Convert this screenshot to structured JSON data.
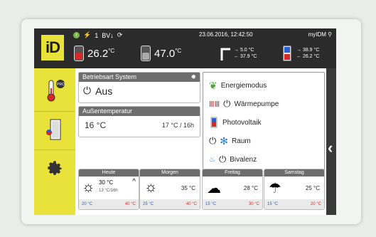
{
  "topbar": {
    "status_icons": {
      "badge": "i",
      "cloud_count": "1",
      "mode": "BV↓",
      "sync": "⟳"
    },
    "datetime": "23.06.2016, 12:42:50",
    "device": "myIDM",
    "tank1_temp": "26.2",
    "tank1_unit": "°C",
    "tank2_temp": "47.0",
    "tank2_unit": "°C",
    "flow_top": "→ 5.0 °C",
    "flow_bottom": "← 37.9 °C",
    "hp_top": "→ 38.9 °C",
    "hp_bottom": "← 26.2 °C"
  },
  "sidebar": {
    "items": [
      {
        "name": "thermometer",
        "badge": "PRO"
      },
      {
        "name": "door"
      },
      {
        "name": "gear"
      }
    ]
  },
  "system_panel": {
    "title": "Betriebsart System",
    "value": "Aus"
  },
  "outdoor_panel": {
    "title": "Außentemperatur",
    "current": "16 °C",
    "forecast": "17 °C / 16h"
  },
  "modes": {
    "items": [
      {
        "label": "Energiemodus"
      },
      {
        "label": "Wärmepumpe"
      },
      {
        "label": "Photovoltaik"
      },
      {
        "label": "Raum"
      },
      {
        "label": "Bivalenz"
      }
    ]
  },
  "weather": {
    "days": [
      {
        "day": "Heute",
        "temp": "30 °C",
        "sub": "13 °C/16h",
        "min": "20 °C",
        "max": "40 °C"
      },
      {
        "day": "Morgen",
        "temp": "35 °C",
        "min": "25 °C",
        "max": "40 °C"
      },
      {
        "day": "Freitag",
        "temp": "28 °C",
        "min": "15 °C",
        "max": "30 °C"
      },
      {
        "day": "Samstag",
        "temp": "25 °C",
        "min": "15 °C",
        "max": "20 °C"
      }
    ]
  },
  "colors": {
    "accent": "#e8e23a",
    "dark": "#2b2b2b",
    "cold": "#2a5fd1",
    "hot": "#d42a2a"
  }
}
